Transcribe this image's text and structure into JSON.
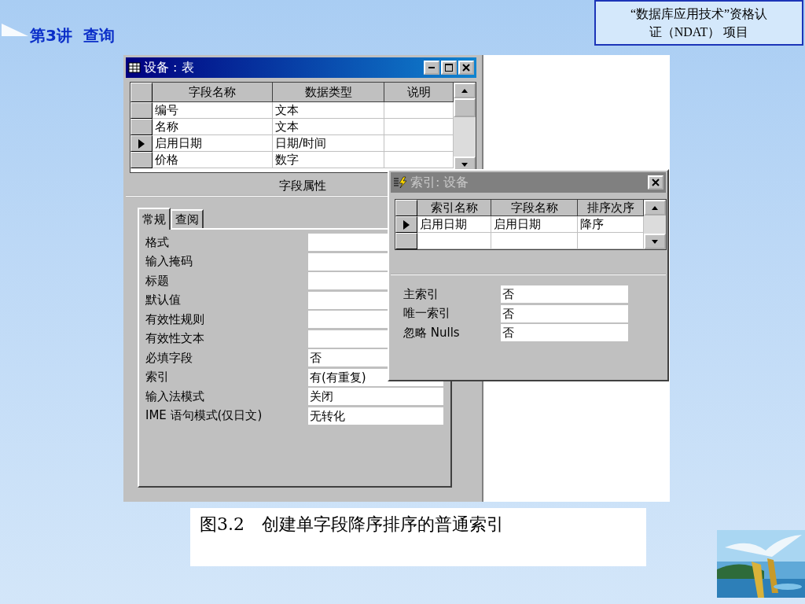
{
  "slide": {
    "lecture_title": "第3讲  查询",
    "project_box": [
      "“数据库应用技术”资格认",
      "证（NDAT） 项目"
    ],
    "caption": "图3.2　创建单字段降序排序的普通索引",
    "logo": {
      "kind": "picture"
    }
  },
  "table_window": {
    "title": "设备 : 表",
    "active": true,
    "columns": [
      "字段名称",
      "数据类型",
      "说明"
    ],
    "rows": [
      {
        "field": "编号",
        "type": "文本",
        "selected": false
      },
      {
        "field": "名称",
        "type": "文本",
        "selected": false
      },
      {
        "field": "启用日期",
        "type": "日期/时间",
        "selected": true
      },
      {
        "field": "价格",
        "type": "数字",
        "selected": false
      }
    ],
    "section_title": "字段属性",
    "tabs": [
      {
        "label": "常规",
        "selected": true
      },
      {
        "label": "查阅",
        "selected": false
      }
    ],
    "properties": [
      {
        "label": "格式"
      },
      {
        "label": "输入掩码"
      },
      {
        "label": "标题"
      },
      {
        "label": "默认值"
      },
      {
        "label": "有效性规则"
      },
      {
        "label": "有效性文本"
      },
      {
        "label": "必填字段",
        "value": "否"
      },
      {
        "label": "索引",
        "value": "有(有重复)"
      },
      {
        "label": "输入法模式",
        "value": "关闭"
      },
      {
        "label": "IME 语句模式(仅日文)",
        "value": "无转化"
      }
    ]
  },
  "index_window": {
    "title": "索引: 设备",
    "active": false,
    "columns": [
      "索引名称",
      "字段名称",
      "排序次序"
    ],
    "rows": [
      {
        "cells": [
          "启用日期",
          "启用日期",
          "降序"
        ],
        "selected": true
      }
    ],
    "properties": [
      {
        "label": "主索引",
        "value": "否"
      },
      {
        "label": "唯一索引",
        "value": "否"
      },
      {
        "label": "忽略 Nulls",
        "value": "否"
      }
    ]
  }
}
